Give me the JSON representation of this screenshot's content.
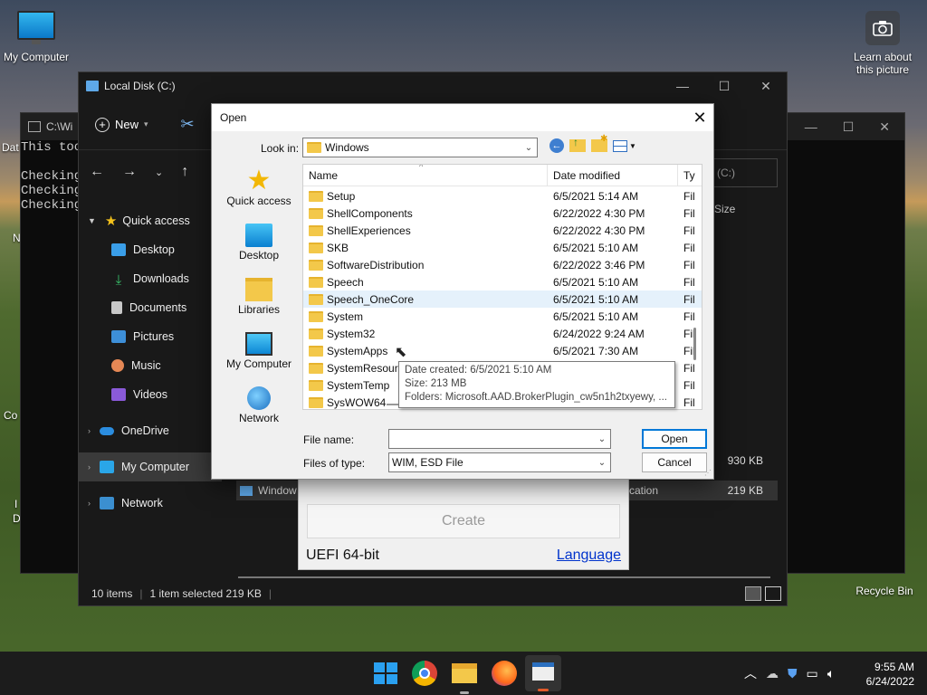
{
  "desktop": {
    "icons": {
      "my_computer": "My Computer",
      "learn": "Learn about this picture",
      "recycle": "Recycle Bin"
    },
    "partial": {
      "dat": "Dat",
      "n": "N",
      "co": "Co",
      "i": "I",
      "d": "D"
    }
  },
  "console": {
    "title": "C:\\Wi",
    "lines": [
      "This too",
      "",
      "Checking",
      "Checking",
      "Checking"
    ]
  },
  "explorer": {
    "title": "Local Disk (C:)",
    "new_label": "New",
    "search_placeholder": "(C:)",
    "size_header": "Size",
    "nav": {
      "quick_access": "Quick access",
      "desktop": "Desktop",
      "downloads": "Downloads",
      "documents": "Documents",
      "pictures": "Pictures",
      "music": "Music",
      "videos": "Videos",
      "onedrive": "OneDrive",
      "my_computer": "My Computer",
      "network": "Network"
    },
    "rows": [
      {
        "name": "",
        "type": "",
        "size": "930 KB"
      },
      {
        "name": "Window",
        "type": "cation",
        "size": "219 KB"
      }
    ],
    "status": {
      "items": "10 items",
      "selected": "1 item selected  219 KB"
    }
  },
  "rufus": {
    "create": "Create",
    "uefi": "UEFI 64-bit",
    "language": "Language"
  },
  "dialog": {
    "title": "Open",
    "look_in_label": "Look in:",
    "look_in_value": "Windows",
    "places": [
      "Quick access",
      "Desktop",
      "Libraries",
      "My Computer",
      "Network"
    ],
    "columns": {
      "name": "Name",
      "date": "Date modified",
      "type": "Ty"
    },
    "files": [
      {
        "name": "Setup",
        "date": "6/5/2021 5:14 AM",
        "type": "Fil"
      },
      {
        "name": "ShellComponents",
        "date": "6/22/2022 4:30 PM",
        "type": "Fil"
      },
      {
        "name": "ShellExperiences",
        "date": "6/22/2022 4:30 PM",
        "type": "Fil"
      },
      {
        "name": "SKB",
        "date": "6/5/2021 5:10 AM",
        "type": "Fil"
      },
      {
        "name": "SoftwareDistribution",
        "date": "6/22/2022 3:46 PM",
        "type": "Fil"
      },
      {
        "name": "Speech",
        "date": "6/5/2021 5:10 AM",
        "type": "Fil"
      },
      {
        "name": "Speech_OneCore",
        "date": "6/5/2021 5:10 AM",
        "type": "Fil"
      },
      {
        "name": "System",
        "date": "6/5/2021 5:10 AM",
        "type": "Fil"
      },
      {
        "name": "System32",
        "date": "6/24/2022 9:24 AM",
        "type": "Fil"
      },
      {
        "name": "SystemApps",
        "date": "6/5/2021 7:30 AM",
        "type": "Fil"
      },
      {
        "name": "SystemResources",
        "date": "",
        "type": "Fil"
      },
      {
        "name": "SystemTemp",
        "date": "",
        "type": "Fil"
      },
      {
        "name": "SysWOW64",
        "date": "",
        "type": "Fil"
      }
    ],
    "tooltip": {
      "created": "Date created: 6/5/2021 5:10 AM",
      "size": "Size: 213 MB",
      "folders": "Folders: Microsoft.AAD.BrokerPlugin_cw5n1h2txyewy, ..."
    },
    "file_name_label": "File name:",
    "file_name_value": "",
    "files_of_type_label": "Files of type:",
    "files_of_type_value": "WIM, ESD File",
    "open_button": "Open",
    "cancel_button": "Cancel"
  },
  "taskbar": {
    "time": "9:55 AM",
    "date": "6/24/2022"
  },
  "colors": {
    "accent": "#0078d7",
    "folder": "#f3c84a",
    "dark_window": "#191919",
    "taskbar": "#1c1c1c"
  }
}
